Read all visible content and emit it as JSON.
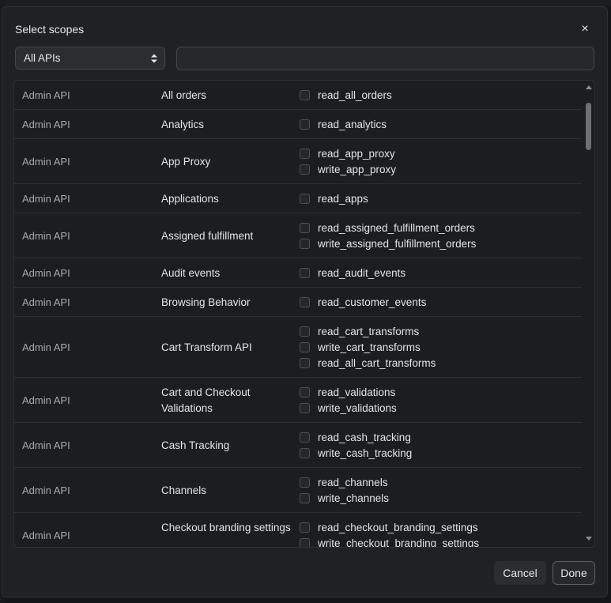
{
  "dialog": {
    "title": "Select scopes",
    "close_glyph": "×"
  },
  "filter": {
    "select_value": "All APIs",
    "search_value": "",
    "search_placeholder": ""
  },
  "rows": [
    {
      "api": "Admin API",
      "name": "All orders",
      "scopes": [
        "read_all_orders"
      ]
    },
    {
      "api": "Admin API",
      "name": "Analytics",
      "scopes": [
        "read_analytics"
      ]
    },
    {
      "api": "Admin API",
      "name": "App Proxy",
      "scopes": [
        "read_app_proxy",
        "write_app_proxy"
      ]
    },
    {
      "api": "Admin API",
      "name": "Applications",
      "scopes": [
        "read_apps"
      ]
    },
    {
      "api": "Admin API",
      "name": "Assigned fulfillment",
      "scopes": [
        "read_assigned_fulfillment_orders",
        "write_assigned_fulfillment_orders"
      ]
    },
    {
      "api": "Admin API",
      "name": "Audit events",
      "scopes": [
        "read_audit_events"
      ]
    },
    {
      "api": "Admin API",
      "name": "Browsing Behavior",
      "scopes": [
        "read_customer_events"
      ]
    },
    {
      "api": "Admin API",
      "name": "Cart Transform API",
      "scopes": [
        "read_cart_transforms",
        "write_cart_transforms",
        "read_all_cart_transforms"
      ]
    },
    {
      "api": "Admin API",
      "name": "Cart and Checkout Validations",
      "scopes": [
        "read_validations",
        "write_validations"
      ]
    },
    {
      "api": "Admin API",
      "name": "Cash Tracking",
      "scopes": [
        "read_cash_tracking",
        "write_cash_tracking"
      ]
    },
    {
      "api": "Admin API",
      "name": "Channels",
      "scopes": [
        "read_channels",
        "write_channels"
      ]
    },
    {
      "api": "Admin API",
      "name": "Checkout branding settings",
      "scopes": [
        "read_checkout_branding_settings",
        "write_checkout_branding_settings"
      ]
    }
  ],
  "buttons": {
    "cancel": "Cancel",
    "done": "Done"
  },
  "icons": {
    "close": "close-icon",
    "select_arrows": "chevron-up-down-icon"
  }
}
